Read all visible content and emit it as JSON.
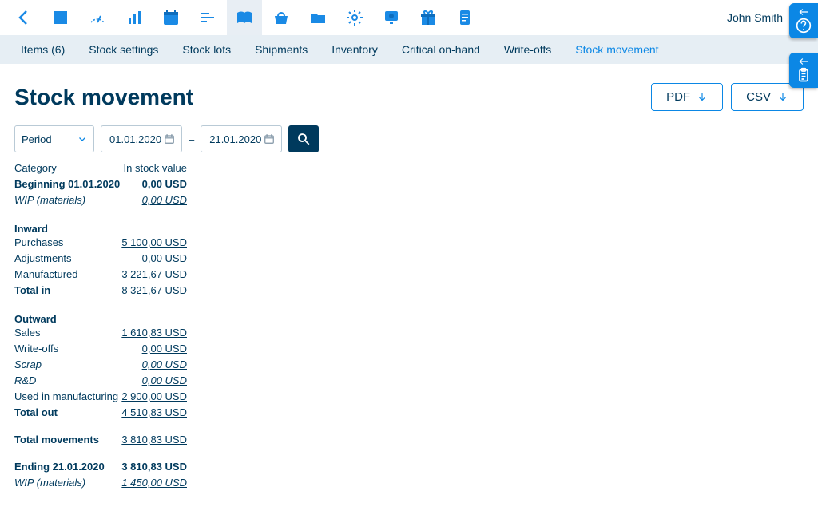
{
  "user_name": "John Smith",
  "tabs": {
    "items": "Items (6)",
    "stock_settings": "Stock settings",
    "stock_lots": "Stock lots",
    "shipments": "Shipments",
    "inventory": "Inventory",
    "critical": "Critical on-hand",
    "write_offs": "Write-offs",
    "stock_movement": "Stock movement"
  },
  "page_title": "Stock movement",
  "export": {
    "pdf": "PDF",
    "csv": "CSV"
  },
  "filters": {
    "period_label": "Period",
    "from": "01.01.2020",
    "to": "21.01.2020"
  },
  "table": {
    "header_category": "Category",
    "header_value": "In stock value",
    "beginning_label": "Beginning 01.01.2020",
    "beginning_value": "0,00 USD",
    "wip_label": "WIP (materials)",
    "wip_begin_value": "0,00 USD",
    "inward_title": "Inward",
    "purchases_label": "Purchases",
    "purchases_value": "5 100,00 USD",
    "adjustments_label": "Adjustments",
    "adjustments_value": "0,00 USD",
    "manufactured_label": "Manufactured",
    "manufactured_value": "3 221,67 USD",
    "total_in_label": "Total in",
    "total_in_value": "8 321,67 USD",
    "outward_title": "Outward",
    "sales_label": "Sales",
    "sales_value": "1 610,83 USD",
    "writeoffs_label": "Write-offs",
    "writeoffs_value": "0,00 USD",
    "scrap_label": "Scrap",
    "scrap_value": "0,00 USD",
    "rd_label": "R&D",
    "rd_value": "0,00 USD",
    "used_mfg_label": "Used in manufacturing",
    "used_mfg_value": "2 900,00 USD",
    "total_out_label": "Total out",
    "total_out_value": "4 510,83 USD",
    "total_movements_label": "Total movements",
    "total_movements_value": "3 810,83 USD",
    "ending_label": "Ending 21.01.2020",
    "ending_value": "3 810,83 USD",
    "wip_end_label": "WIP (materials)",
    "wip_end_value": "1 450,00 USD"
  }
}
